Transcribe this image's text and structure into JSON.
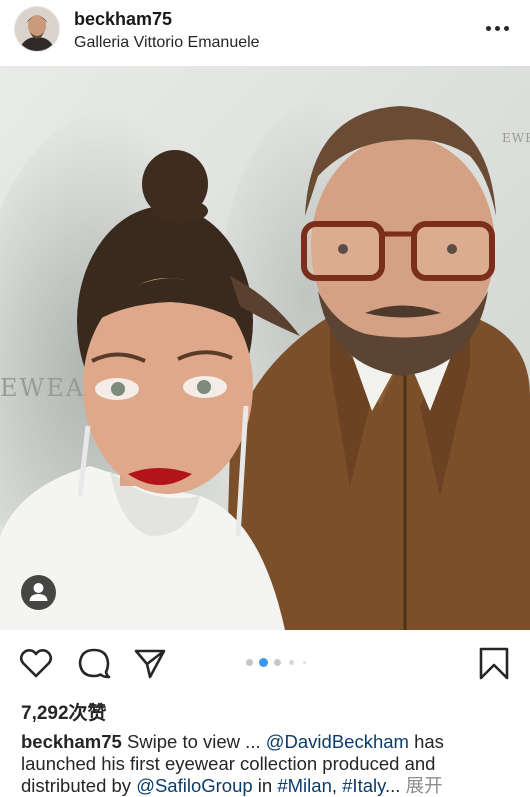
{
  "post": {
    "username": "beckham75",
    "location": "Galleria Vittorio Emanuele"
  },
  "photo": {
    "backdrop_text": "EWEAR",
    "backdrop_text_right": "EWEA",
    "carousel": {
      "count": 5,
      "active": 2
    }
  },
  "likes": {
    "label": "7,292次赞"
  },
  "caption": {
    "username": "beckham75",
    "text_before_mention": "Swipe to view ... ",
    "mention1": "@DavidBeckham",
    "text_after_mention": " has launched his first eyewear collection produced and distributed by ",
    "mention2": "@SafiloGroup",
    "text_in": " in ",
    "hashtag1": "#Milan",
    "comma": ", ",
    "hashtag2": "#Italy",
    "ellipsis": "...",
    "more_label": "展开"
  },
  "colors": {
    "text": "#262626",
    "link": "#0c3c6e",
    "muted": "#8e8e8e",
    "carousel_active": "#3897f0"
  },
  "icons": [
    "avatar",
    "more-options-icon",
    "heart-icon",
    "comment-icon",
    "share-icon",
    "bookmark-icon",
    "user-tag-icon"
  ]
}
